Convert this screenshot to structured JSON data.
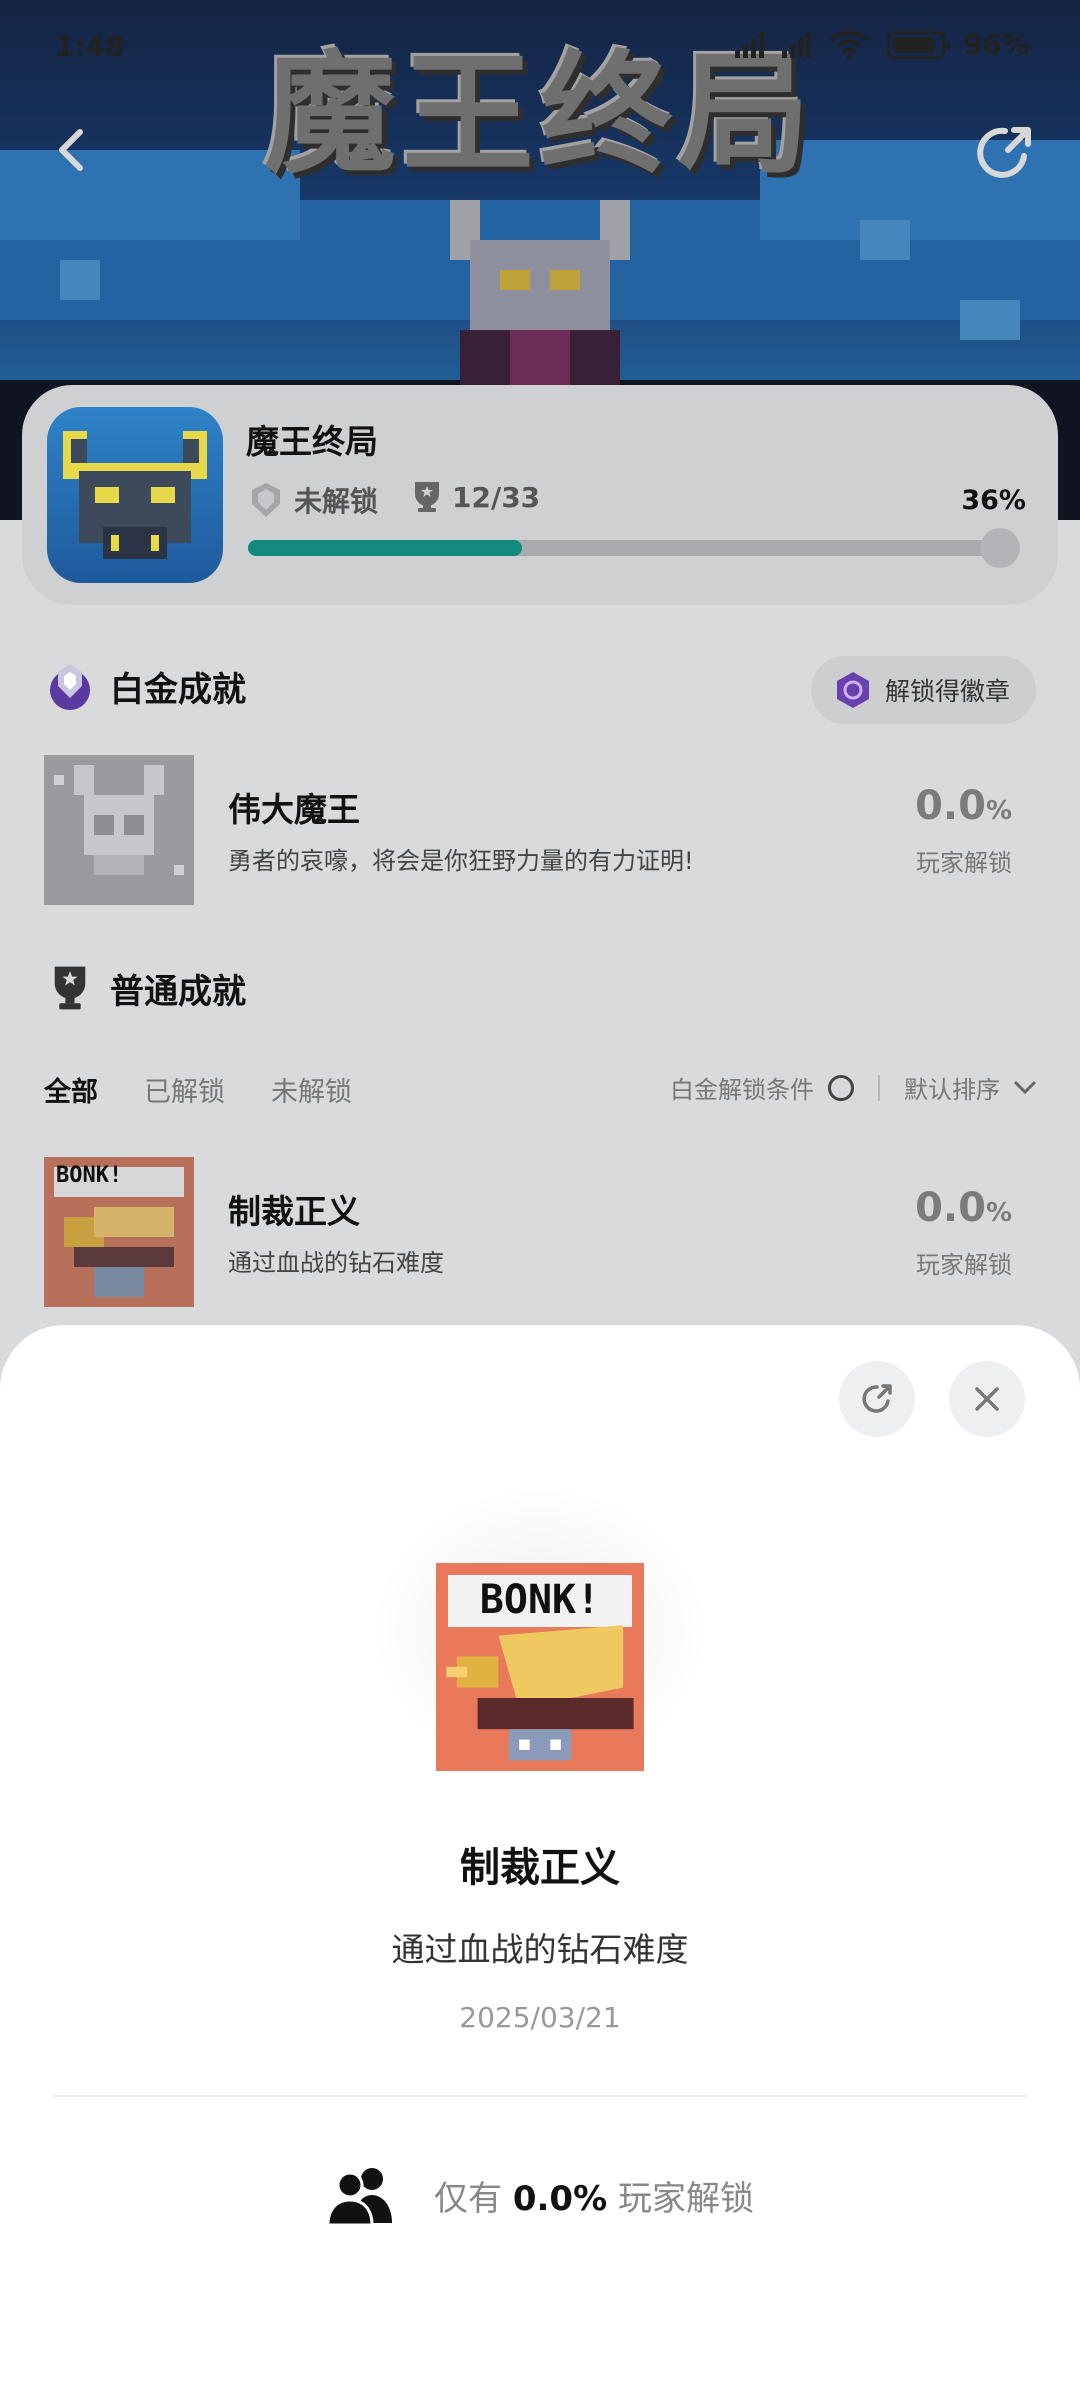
{
  "status_bar": {
    "time": "1:48",
    "battery": "96%"
  },
  "hero": {
    "logo_text": "魔王终局"
  },
  "game": {
    "title": "魔王终局",
    "lock_status": "未解锁",
    "trophy_count": "12/33",
    "progress_percent": "36%",
    "progress_value": 0.36
  },
  "platinum": {
    "section_title": "白金成就",
    "badge_button": "解锁得徽章",
    "achievement": {
      "name": "伟大魔王",
      "desc": "勇者的哀嚎，将会是你狂野力量的有力证明!",
      "pct": "0.0",
      "pct_unit": "%",
      "sub": "玩家解锁"
    }
  },
  "normal": {
    "section_title": "普通成就",
    "tabs": [
      "全部",
      "已解锁",
      "未解锁"
    ],
    "filter_label": "白金解锁条件",
    "sort_label": "默认排序",
    "achievement": {
      "name": "制裁正义",
      "desc": "通过血战的钻石难度",
      "pct": "0.0",
      "pct_unit": "%",
      "sub": "玩家解锁"
    }
  },
  "sheet": {
    "title": "制裁正义",
    "desc": "通过血战的钻石难度",
    "date": "2025/03/21",
    "stat_prefix": "仅有",
    "stat_value": "0.0%",
    "stat_suffix": "玩家解锁",
    "art_text": "BONK!"
  },
  "colors": {
    "progress": "#138a80",
    "accent_purple": "#6a3fb0",
    "art_bg": "#e8795a"
  }
}
